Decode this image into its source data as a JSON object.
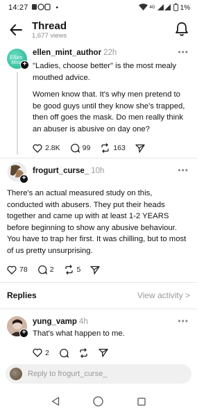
{
  "status": {
    "time": "14:27",
    "battery": "1%",
    "network": "4G"
  },
  "header": {
    "title": "Thread",
    "views": "1,677 views"
  },
  "posts": [
    {
      "username": "ellen_mint_author",
      "ago": "22h",
      "paragraphs": [
        "\"Ladies, choose better\" is the most mealy mouthed advice.",
        "Women know that. It's why men pretend to be good guys until they know she's trapped, then off goes the mask. Do men really think an abuser is abusive on day one?"
      ],
      "likes": "2.8K",
      "comments": "99",
      "reposts": "163"
    },
    {
      "username": "frogurt_curse_",
      "ago": "10h",
      "paragraphs": [
        "There's an actual measured study on this, conducted with abusers. They put their heads together and came up with at least 1-2 YEARS before beginning to show any abusive behaviour. You have to trap her first. It was chilling, but to most of us pretty unsurprising."
      ],
      "likes": "78",
      "comments": "2",
      "reposts": "5"
    }
  ],
  "replies_header": {
    "label": "Replies",
    "link": "View activity >"
  },
  "replies": [
    {
      "username": "yung_vamp",
      "ago": "4h",
      "text": "That's what happen to me.",
      "likes": "2"
    }
  ],
  "composer": {
    "placeholder": "Reply to frogurt_curse_"
  },
  "colors": {
    "accent_green": "#2ec4a0",
    "muted": "#9a9a9a"
  }
}
